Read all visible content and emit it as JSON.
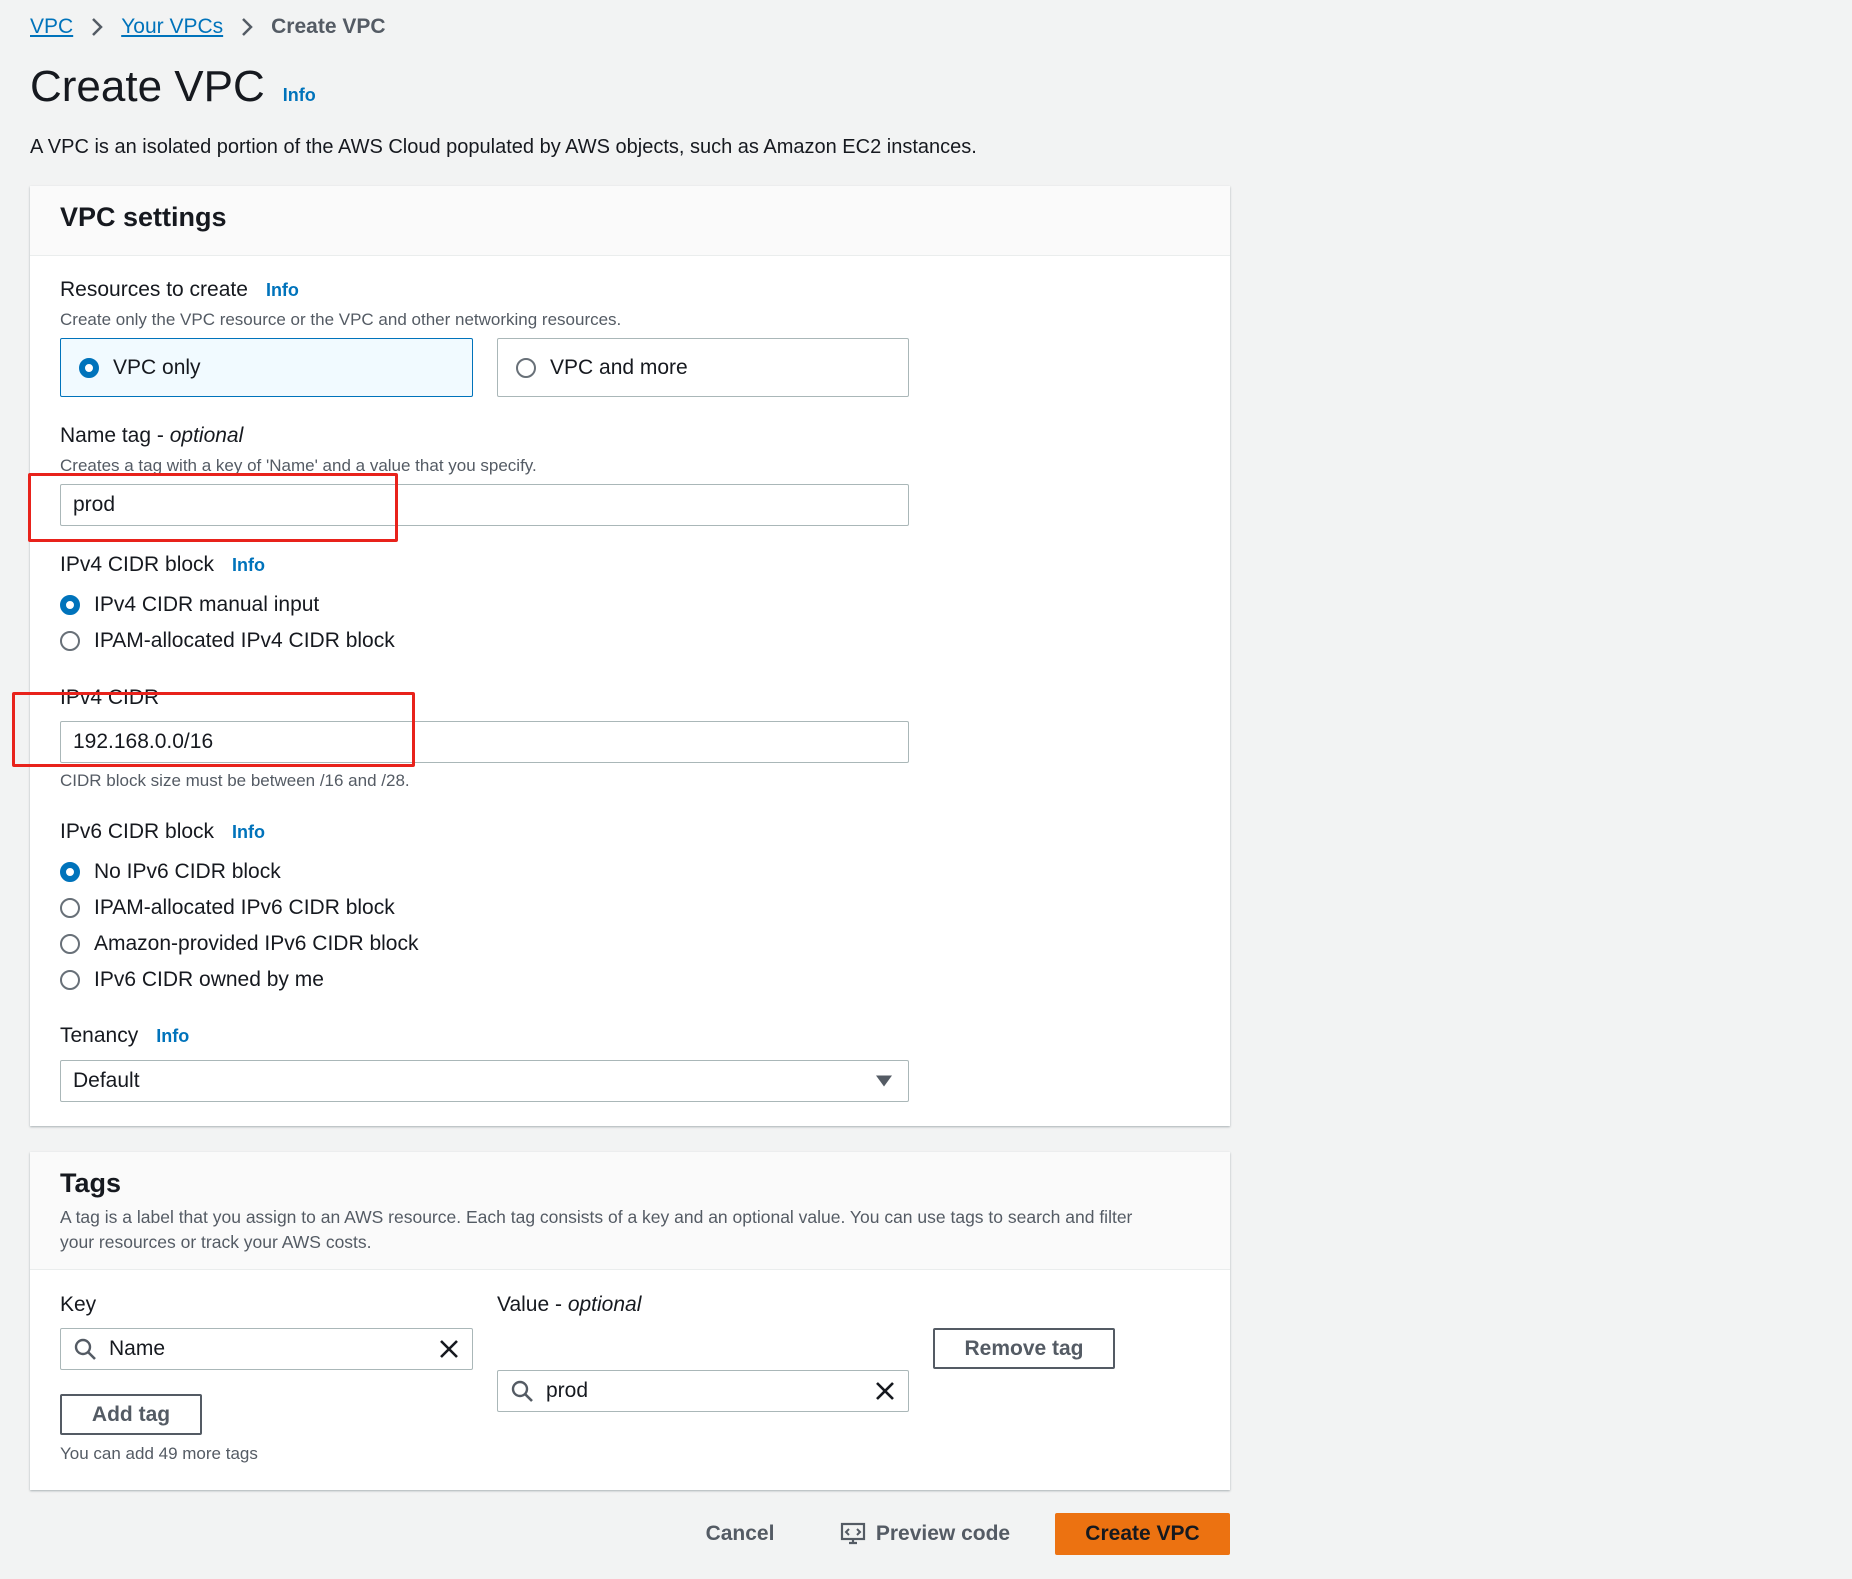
{
  "breadcrumb": {
    "items": [
      "VPC",
      "Your VPCs"
    ],
    "current": "Create VPC"
  },
  "page": {
    "title": "Create VPC",
    "info": "Info",
    "description": "A VPC is an isolated portion of the AWS Cloud populated by AWS objects, such as Amazon EC2 instances."
  },
  "vpc_settings": {
    "title": "VPC settings",
    "resources": {
      "label": "Resources to create",
      "info": "Info",
      "hint": "Create only the VPC resource or the VPC and other networking resources.",
      "options": [
        "VPC only",
        "VPC and more"
      ],
      "selected": "VPC only"
    },
    "name_tag": {
      "label": "Name tag - ",
      "optional": "optional",
      "hint": "Creates a tag with a key of 'Name' and a value that you specify.",
      "value": "prod"
    },
    "ipv4_block": {
      "label": "IPv4 CIDR block",
      "info": "Info",
      "options": [
        "IPv4 CIDR manual input",
        "IPAM-allocated IPv4 CIDR block"
      ],
      "selected": "IPv4 CIDR manual input"
    },
    "ipv4_cidr": {
      "label": "IPv4 CIDR",
      "value": "192.168.0.0/16",
      "hint": "CIDR block size must be between /16 and /28."
    },
    "ipv6_block": {
      "label": "IPv6 CIDR block",
      "info": "Info",
      "options": [
        "No IPv6 CIDR block",
        "IPAM-allocated IPv6 CIDR block",
        "Amazon-provided IPv6 CIDR block",
        "IPv6 CIDR owned by me"
      ],
      "selected": "No IPv6 CIDR block"
    },
    "tenancy": {
      "label": "Tenancy",
      "info": "Info",
      "value": "Default"
    }
  },
  "tags": {
    "title": "Tags",
    "description_line1": "A tag is a label that you assign to an AWS resource. Each tag consists of a key and an optional value. You can use tags to search and filter",
    "description_line2": "your resources or track your AWS costs.",
    "key_label": "Key",
    "value_label": "Value - ",
    "value_optional": "optional",
    "key_value": "Name",
    "value_value": "prod",
    "remove_label": "Remove tag",
    "add_label": "Add tag",
    "remaining": "You can add 49 more tags"
  },
  "footer": {
    "cancel": "Cancel",
    "preview": "Preview code",
    "create": "Create VPC"
  },
  "colors": {
    "accent": "#0073bb",
    "primary_button": "#ec7211",
    "highlight": "#e8221b"
  }
}
